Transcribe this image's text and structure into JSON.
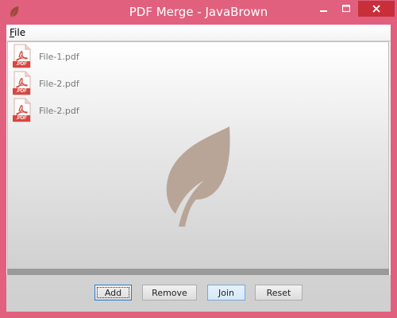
{
  "window": {
    "title": "PDF Merge - JavaBrown",
    "icons": {
      "app": "leaf-icon",
      "minimize": "minimize-icon",
      "maximize": "maximize-icon",
      "close": "close-icon"
    }
  },
  "menu": {
    "file_mnemonic": "F",
    "file_rest": "ile"
  },
  "files": [
    {
      "name": "File-1.pdf",
      "icon_label": ".PDF"
    },
    {
      "name": "File-2.pdf",
      "icon_label": ".PDF"
    },
    {
      "name": "File-2.pdf",
      "icon_label": ".PDF"
    }
  ],
  "buttons": {
    "add": "Add",
    "remove": "Remove",
    "join": "Join",
    "reset": "Reset"
  },
  "colors": {
    "frame": "#e0607e",
    "close_button": "#c7303a",
    "pdf_red": "#d6473f",
    "watermark": "#b8a597"
  }
}
